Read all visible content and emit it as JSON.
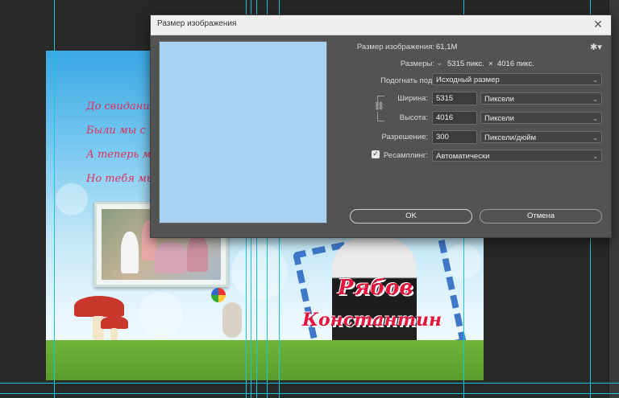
{
  "dialog": {
    "title": "Размер изображения",
    "image_size_label": "Размер изображения:",
    "image_size_value": "61,1M",
    "dimensions_label": "Размеры:",
    "dimensions_value": "5315 пикс.  ×  4016 пикс.",
    "fit_to_label": "Подогнать под:",
    "fit_to_value": "Исходный размер",
    "width_label": "Ширина:",
    "width_value": "5315",
    "width_unit": "Пиксели",
    "height_label": "Высота:",
    "height_value": "4016",
    "height_unit": "Пиксели",
    "resolution_label": "Разрешение:",
    "resolution_value": "300",
    "resolution_unit": "Пиксели/дюйм",
    "resample_label": "Ресамплинг:",
    "resample_value": "Автоматически",
    "resample_checked": true,
    "ok_label": "OK",
    "cancel_label": "Отмена"
  },
  "document": {
    "poem_lines": [
      "До свидания, наш люб",
      "Были мы с тобою",
      "А теперь мы расст",
      "Но тебя мы не заб"
    ],
    "name_first": "Рябов",
    "name_last": "Константин"
  },
  "icons": {
    "close": "close-icon",
    "gear": "gear-icon",
    "link": "link-icon",
    "chevron": "chevron-down-icon",
    "check": "checkmark-icon"
  },
  "colors": {
    "guide": "#17c6d8",
    "dialog_bg": "#535353",
    "accent_text": "#e4143c"
  }
}
